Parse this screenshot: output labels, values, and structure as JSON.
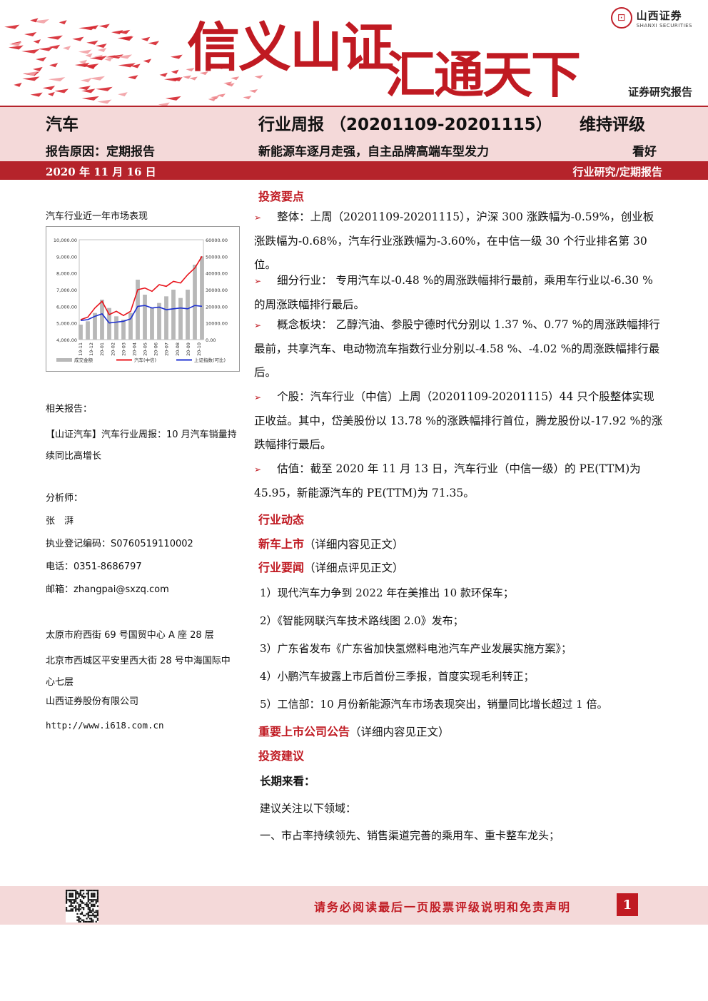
{
  "header": {
    "logo_cn": "山西证券",
    "logo_en": "SHANXI SECURITIES",
    "slogan_part1": "信义山证",
    "slogan_part2": "汇通天下",
    "report_type": "证券研究报告"
  },
  "title": {
    "sector": "汽车",
    "weekly": "行业周报 （20201109-20201115）",
    "rating_label": "维持评级",
    "reason": "报告原因：定期报告",
    "headline": "新能源车逐月走强，自主品牌高端车型发力",
    "rating": "看好",
    "date": "2020 年 11 月 16 日",
    "series": "行业研究/定期报告"
  },
  "left": {
    "chart_title": "汽车行业近一年市场表现",
    "related_title": "相关报告：",
    "related_report": "【山证汽车】汽车行业周报：10 月汽车销量持续同比高增长",
    "analyst_title": "分析师：",
    "analyst_name": "张　湃",
    "license": "执业登记编码：S0760519110002",
    "phone": "电话：0351-8686797",
    "email": "邮箱：zhangpai@sxzq.com",
    "address1": "太原市府西街 69 号国贸中心 A 座 28 层",
    "address2": "北京市西城区平安里西大街 28 号中海国际中心七层",
    "company": "山西证券股份有限公司",
    "url": "http://www.i618.com.cn"
  },
  "chart_data": {
    "type": "line",
    "x": [
      "19-11",
      "19-12",
      "20-01",
      "20-02",
      "20-03",
      "20-04",
      "20-05",
      "20-06",
      "20-07",
      "20-08",
      "20-09",
      "20-10"
    ],
    "y_left_ticks": [
      "10,000.00",
      "9,000.00",
      "8,000.00",
      "7,000.00",
      "6,000.00",
      "5,000.00",
      "4,000.00"
    ],
    "y_right_ticks": [
      "60000.00",
      "50000.00",
      "40000.00",
      "30000.00",
      "20000.00",
      "10000.00",
      "0.00"
    ],
    "ylim_left": [
      4000,
      10000
    ],
    "ylim_right": [
      0,
      60000
    ],
    "series": [
      {
        "name": "成交金额",
        "type": "bar",
        "color": "#b8b8b8",
        "values": [
          9000,
          11000,
          16000,
          24000,
          19000,
          14000,
          12000,
          16000,
          36000,
          27000,
          19000,
          22000,
          26000,
          30000,
          25000,
          30000,
          45000,
          50000
        ]
      },
      {
        "name": "汽车(中信)",
        "color": "#e8131b",
        "values": [
          5200,
          5350,
          5900,
          6300,
          5500,
          5700,
          5450,
          5700,
          7000,
          7100,
          6900,
          7300,
          7200,
          7500,
          7400,
          7900,
          8300,
          9000
        ]
      },
      {
        "name": "上证指数(可比)",
        "color": "#1c2fd0",
        "values": [
          5150,
          5200,
          5400,
          5550,
          5000,
          5050,
          5100,
          5250,
          6000,
          6050,
          5900,
          5950,
          5800,
          5850,
          5900,
          5850,
          6050,
          6000
        ]
      }
    ],
    "legend_position": "bottom"
  },
  "right": {
    "invest_title": "投资要点",
    "b1": "整体：上周（20201109-20201115），沪深 300 涨跌幅为-0.59%，创业板涨跌幅为-0.68%，汽车行业涨跌幅为-3.60%，在中信一级 30 个行业排名第 30 位。",
    "b2": "细分行业： 专用汽车以-0.48 %的周涨跌幅排行最前，乘用车行业以-6.30 %的周涨跌幅排行最后。",
    "b3": "概念板块： 乙醇汽油、参股宁德时代分别以 1.37 %、0.77 %的周涨跌幅排行最前，共享汽车、电动物流车指数行业分别以-4.58 %、-4.02 %的周涨跌幅排行最后。",
    "b4": "个股：汽车行业（中信）上周（20201109-20201115）44 只个股整体实现正收益。其中，岱美股份以 13.78 %的涨跌幅排行首位，腾龙股份以-17.92 %的涨跌幅排行最后。",
    "b5": "估值：截至 2020 年 11 月 13 日，汽车行业（中信一级）的 PE(TTM)为 45.95，新能源汽车的 PE(TTM)为 71.35。",
    "dyn_title": "行业动态",
    "new_car": "新车上市",
    "new_car_note": "（详细内容见正文）",
    "news": "行业要闻",
    "news_note": "（详细点评见正文）",
    "n1": "1）现代汽车力争到 2022 年在美推出 10 款环保车；",
    "n2": "2）《智能网联汽车技术路线图 2.0》发布；",
    "n3": "3）广东省发布《广东省加快氢燃料电池汽车产业发展实施方案》；",
    "n4": "4）小鹏汽车披露上市后首份三季报，首度实现毛利转正；",
    "n5": "5）工信部：10 月份新能源汽车市场表现突出，销量同比增长超过 1 倍。",
    "announce": "重要上市公司公告",
    "announce_note": "（详细内容见正文）",
    "advice_title": "投资建议",
    "long_term": "长期来看：",
    "suggest": "建议关注以下领域：",
    "s1": "一、市占率持续领先、销售渠道完善的乘用车、重卡整车龙头；"
  },
  "footer": {
    "disclaimer": "请务必阅读最后一页股票评级说明和免责声明",
    "page": "1"
  }
}
